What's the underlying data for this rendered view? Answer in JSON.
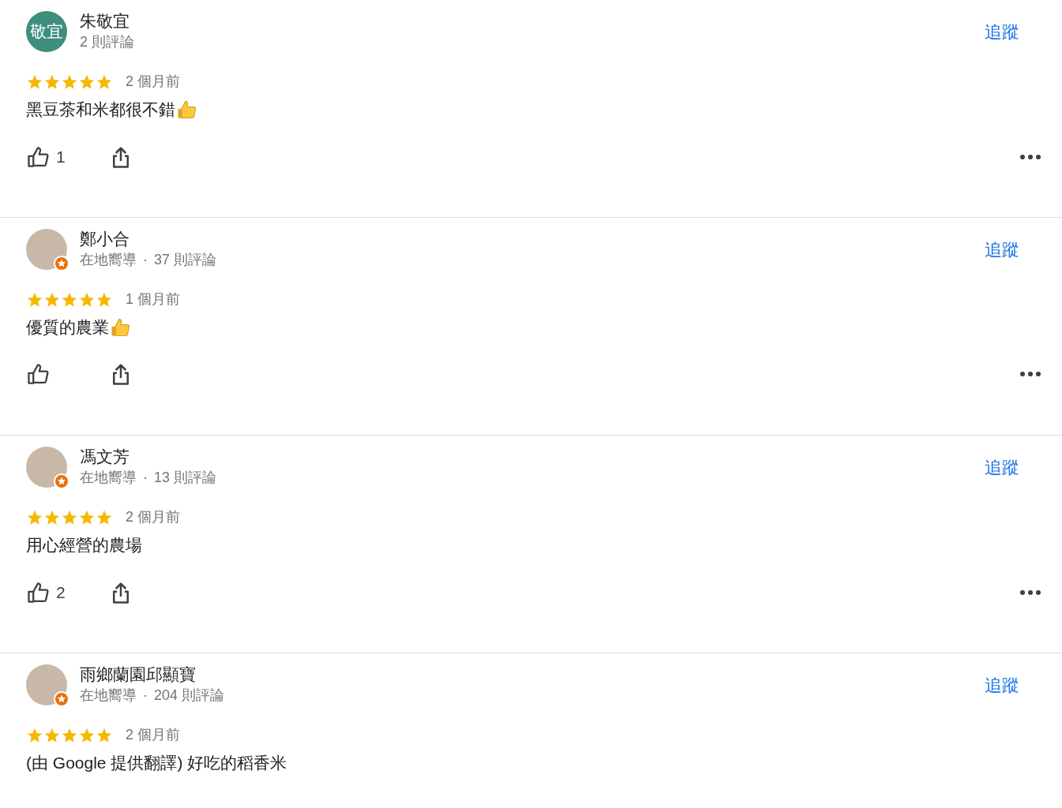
{
  "reviews": [
    {
      "name": "朱敬宜",
      "avatar": {
        "kind": "initials",
        "text": "敬宜",
        "color": "#3e8e7e"
      },
      "local_guide": false,
      "review_count": "2 則評論",
      "follow": "追蹤",
      "stars": 5,
      "time": "2 個月前",
      "text": "黑豆茶和米都很不錯",
      "thumbs_up_emoji": true,
      "actions_shown": true,
      "likes": "1"
    },
    {
      "name": "鄭小合",
      "avatar": {
        "kind": "photo"
      },
      "local_guide": true,
      "guide_label": "在地嚮導",
      "separator": "·",
      "review_count": "37 則評論",
      "follow": "追蹤",
      "stars": 5,
      "time": "1 個月前",
      "text": "優質的農業",
      "thumbs_up_emoji": true,
      "actions_shown": true
    },
    {
      "name": "馮文芳",
      "avatar": {
        "kind": "photo"
      },
      "local_guide": true,
      "guide_label": "在地嚮導",
      "separator": "·",
      "review_count": "13 則評論",
      "follow": "追蹤",
      "stars": 5,
      "time": "2 個月前",
      "text": "用心經營的農場",
      "thumbs_up_emoji": false,
      "actions_shown": true,
      "likes": "2"
    },
    {
      "name": "雨鄉蘭園邱顯寶",
      "avatar": {
        "kind": "photo"
      },
      "local_guide": true,
      "guide_label": "在地嚮導",
      "separator": "·",
      "review_count": "204 則評論",
      "follow": "追蹤",
      "stars": 5,
      "time": "2 個月前",
      "text": "(由 Google 提供翻譯) 好吃的稻香米",
      "thumbs_up_emoji": false,
      "actions_shown": false
    }
  ]
}
